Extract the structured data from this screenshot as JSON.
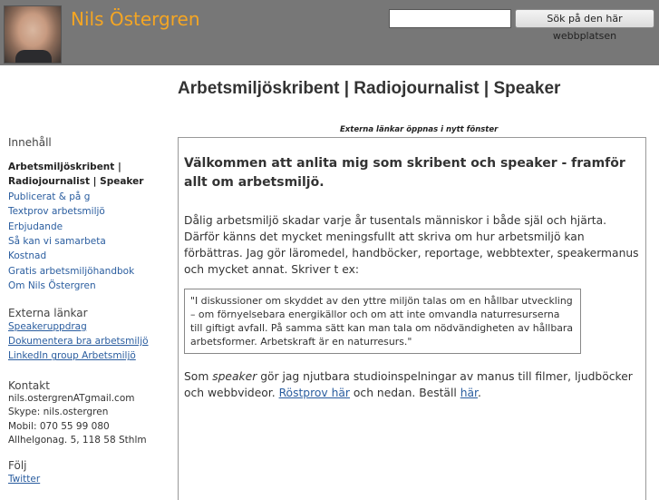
{
  "header": {
    "title": "Nils Östergren",
    "search_placeholder": "",
    "search_button": "Sök på den här webbplatsen"
  },
  "headline": "Arbetsmiljöskribent | Radiojournalist | Speaker",
  "notice": "Externa länkar öppnas i nytt fönster",
  "sidebar": {
    "contents_heading": "Innehåll",
    "current_item": "Arbetsmiljöskribent | Radiojournalist | Speaker",
    "items": [
      "Publicerat & på g",
      "Textprov arbetsmiljö",
      "Erbjudande",
      "Så kan vi samarbeta",
      "Kostnad",
      "Gratis arbetsmiljöhandbok",
      "Om Nils Östergren"
    ],
    "external_heading": "Externa länkar",
    "external_links": [
      "Speakeruppdrag",
      "Dokumentera bra arbetsmiljö",
      "LinkedIn group Arbetsmiljö"
    ],
    "contact_heading": "Kontakt",
    "contact_lines": [
      "nils.ostergrenATgmail.com",
      "Skype: nils.ostergren",
      "Mobil: 070 55 99 080",
      "Allhelgonag. 5, 118 58 Sthlm"
    ],
    "follow_heading": "Följ",
    "follow_links": [
      "Twitter"
    ]
  },
  "content": {
    "heading": "Välkommen att anlita mig som skribent och speaker - framför allt om arbetsmiljö.",
    "paragraph1": "Dålig arbetsmiljö skadar varje år tusentals människor i både själ och hjärta. Därför känns det mycket meningsfullt att skriva om hur arbetsmiljö kan förbättras. Jag gör läromedel, handböcker, reportage, webbtexter, speakermanus och mycket annat. Skriver t ex:",
    "quote": "\"I diskussioner om skyddet av den yttre miljön talas om en hållbar utveckling – om förnyelsebara energikällor och om att inte omvandla naturresurserna till giftigt avfall. På samma sätt kan man tala om nödvändigheten av hållbara arbetsformer. Arbetskraft är en naturresurs.\"",
    "p2_start": "Som ",
    "p2_em": "speaker",
    "p2_mid": " gör jag njutbara studioinspelningar av manus till filmer, ljudböcker och webbvideor. ",
    "p2_link1": "Röstprov här",
    "p2_mid2": " och nedan. Beställ ",
    "p2_link2": "här",
    "p2_end": "."
  }
}
